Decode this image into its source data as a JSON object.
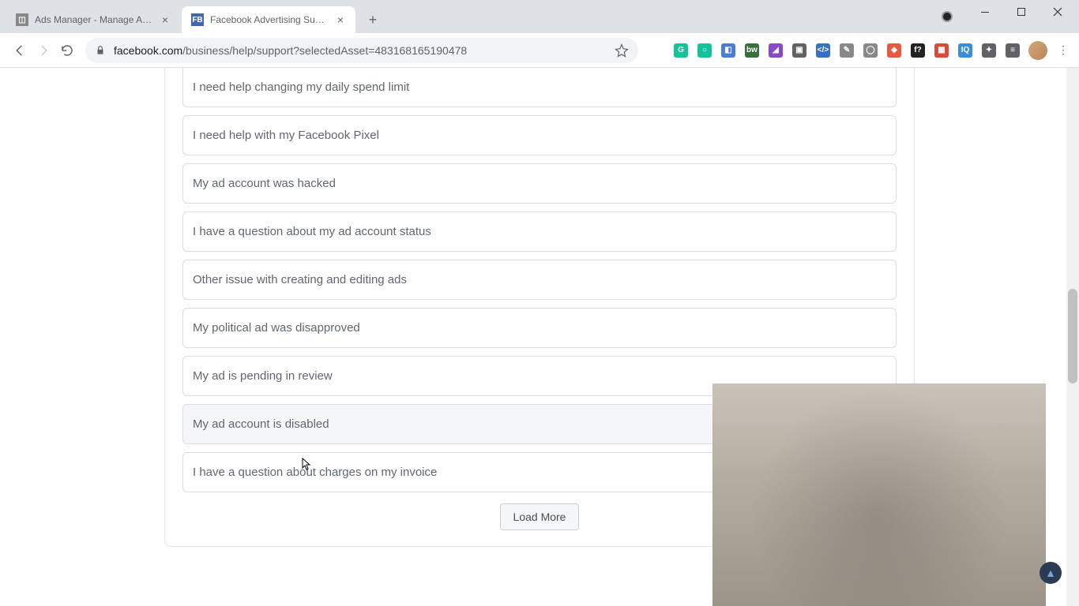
{
  "window": {
    "tabs": [
      {
        "title": "Ads Manager - Manage Ads - Ca",
        "favicon": "AM"
      },
      {
        "title": "Facebook Advertising Support | F",
        "favicon": "FB"
      }
    ],
    "url_host": "facebook.com",
    "url_path": "/business/help/support?selectedAsset=483168165190478"
  },
  "options": [
    "I need help changing my daily spend limit",
    "I need help with my Facebook Pixel",
    "My ad account was hacked",
    "I have a question about my ad account status",
    "Other issue with creating and editing ads",
    "My political ad was disapproved",
    "My ad is pending in review",
    "My ad account is disabled",
    "I have a question about charges on my invoice"
  ],
  "buttons": {
    "load_more": "Load More"
  },
  "hover_index": 7,
  "extensions": [
    {
      "name": "grammarly",
      "glyph": "G",
      "color": "#15c39a"
    },
    {
      "name": "circle-ext",
      "glyph": "○",
      "color": "#15c39a"
    },
    {
      "name": "square-blue",
      "glyph": "◧",
      "color": "#4a7dd8"
    },
    {
      "name": "bw-ext",
      "glyph": "bw",
      "color": "#3a6d3f"
    },
    {
      "name": "purple-ext",
      "glyph": "◢",
      "color": "#8a4ac7"
    },
    {
      "name": "panel-ext",
      "glyph": "▣",
      "color": "#5f6368"
    },
    {
      "name": "code-ext",
      "glyph": "</>",
      "color": "#3571c5"
    },
    {
      "name": "edit-ext",
      "glyph": "✎",
      "color": "#888"
    },
    {
      "name": "circle-grey",
      "glyph": "◯",
      "color": "#888"
    },
    {
      "name": "color-ext",
      "glyph": "◆",
      "color": "#e8573f"
    },
    {
      "name": "f-ext",
      "glyph": "f?",
      "color": "#222"
    },
    {
      "name": "mosaic-ext",
      "glyph": "▦",
      "color": "#d84a3a"
    },
    {
      "name": "iq-ext",
      "glyph": "IQ",
      "color": "#3a8dd8"
    },
    {
      "name": "puzzle-ext",
      "glyph": "✦",
      "color": "#5f6368"
    },
    {
      "name": "list-ext",
      "glyph": "≡",
      "color": "#5f6368"
    }
  ]
}
